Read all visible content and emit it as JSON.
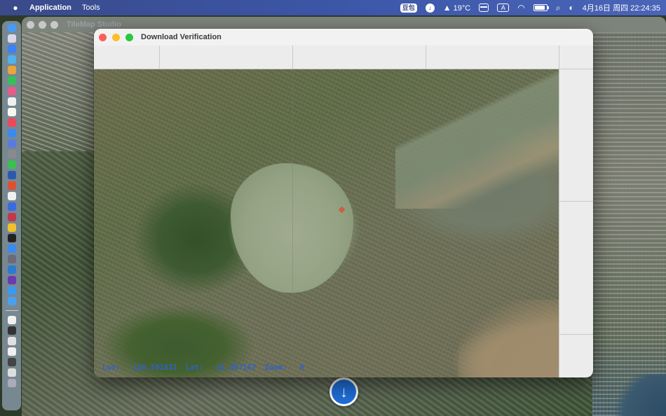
{
  "menubar": {
    "app_name": "Application",
    "menus": [
      "Tools"
    ],
    "input_badge": "豆包",
    "weather": "19°C",
    "input_method": "A",
    "datetime": "4月16日 周四  22:24:35"
  },
  "main_window": {
    "title": "TileMap Studio"
  },
  "verify_window": {
    "title": "Download Verification",
    "status": {
      "lon_label": "Lon:",
      "lon_value": "120.501831",
      "lat_label": "Lat:",
      "lat_value": "31.307167",
      "zoom_label": "Zoom:",
      "zoom_value": "9"
    }
  },
  "download_button": {
    "icon": "download-arrow-icon",
    "glyph": "↓"
  },
  "colors": {
    "accent": "#1f6ed8",
    "coords_text": "#2f62c6",
    "close": "#fe5f57",
    "minimize": "#febc2e",
    "maximize": "#28c840"
  }
}
